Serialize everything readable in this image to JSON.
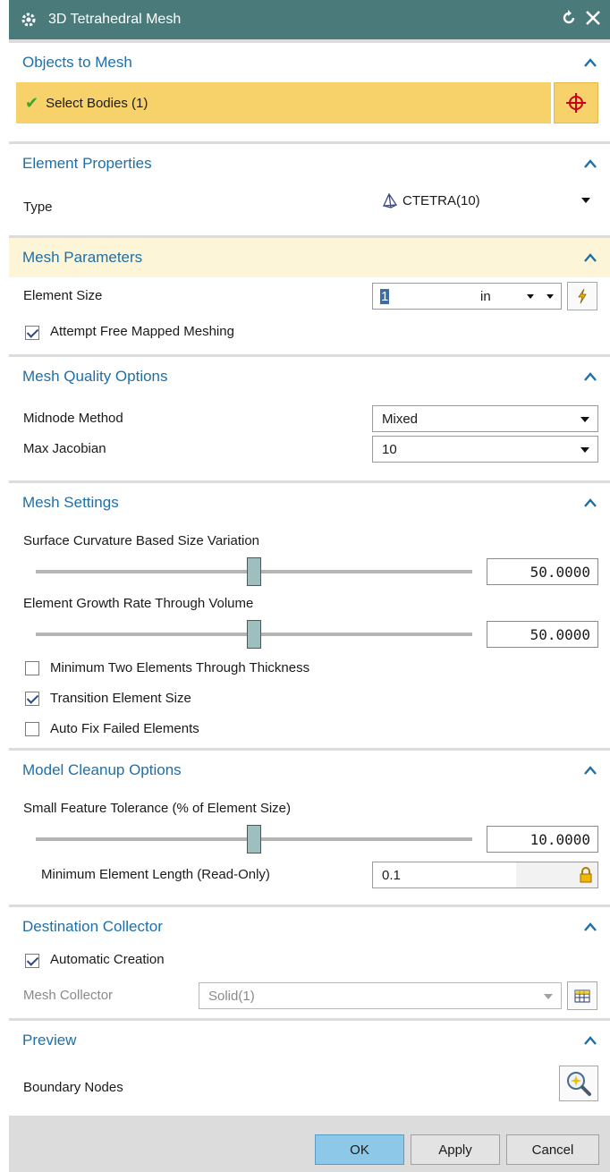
{
  "window": {
    "title": "3D Tetrahedral Mesh"
  },
  "objects": {
    "header": "Objects to Mesh",
    "select_label": "Select Bodies (1)"
  },
  "element_properties": {
    "header": "Element Properties",
    "type_label": "Type",
    "type_value": "CTETRA(10)"
  },
  "mesh_parameters": {
    "header": "Mesh Parameters",
    "element_size_label": "Element Size",
    "element_size_value": "1",
    "unit": "in",
    "free_mapped_label": "Attempt Free Mapped Meshing",
    "free_mapped_checked": true
  },
  "mesh_quality": {
    "header": "Mesh Quality Options",
    "midnode_label": "Midnode Method",
    "midnode_value": "Mixed",
    "jacobian_label": "Max Jacobian",
    "jacobian_value": "10"
  },
  "mesh_settings": {
    "header": "Mesh Settings",
    "curvature_label": "Surface Curvature Based Size Variation",
    "curvature_value": "50.0000",
    "curvature_level": 0.5,
    "growth_label": "Element Growth Rate Through Volume",
    "growth_value": "50.0000",
    "growth_level": 0.5,
    "min_two_label": "Minimum Two Elements Through Thickness",
    "min_two_checked": false,
    "transition_label": "Transition Element Size",
    "transition_checked": true,
    "auto_fix_label": "Auto Fix Failed Elements",
    "auto_fix_checked": false
  },
  "model_cleanup": {
    "header": "Model Cleanup Options",
    "tolerance_label": "Small Feature Tolerance (% of Element Size)",
    "tolerance_value": "10.0000",
    "tolerance_level": 0.5,
    "min_length_label": "Minimum Element Length (Read-Only)",
    "min_length_value": "0.1"
  },
  "destination": {
    "header": "Destination Collector",
    "auto_label": "Automatic Creation",
    "auto_checked": true,
    "collector_label": "Mesh Collector",
    "collector_value": "Solid(1)"
  },
  "preview": {
    "header": "Preview",
    "boundary_label": "Boundary Nodes"
  },
  "footer": {
    "ok": "OK",
    "apply": "Apply",
    "cancel": "Cancel"
  },
  "colors": {
    "title_bar": "#4a7a7a",
    "accent": "#1f6fa8",
    "select_highlight": "#f7d26a",
    "section_highlight": "#fcf5d8",
    "ok_button": "#8ec8e8"
  }
}
